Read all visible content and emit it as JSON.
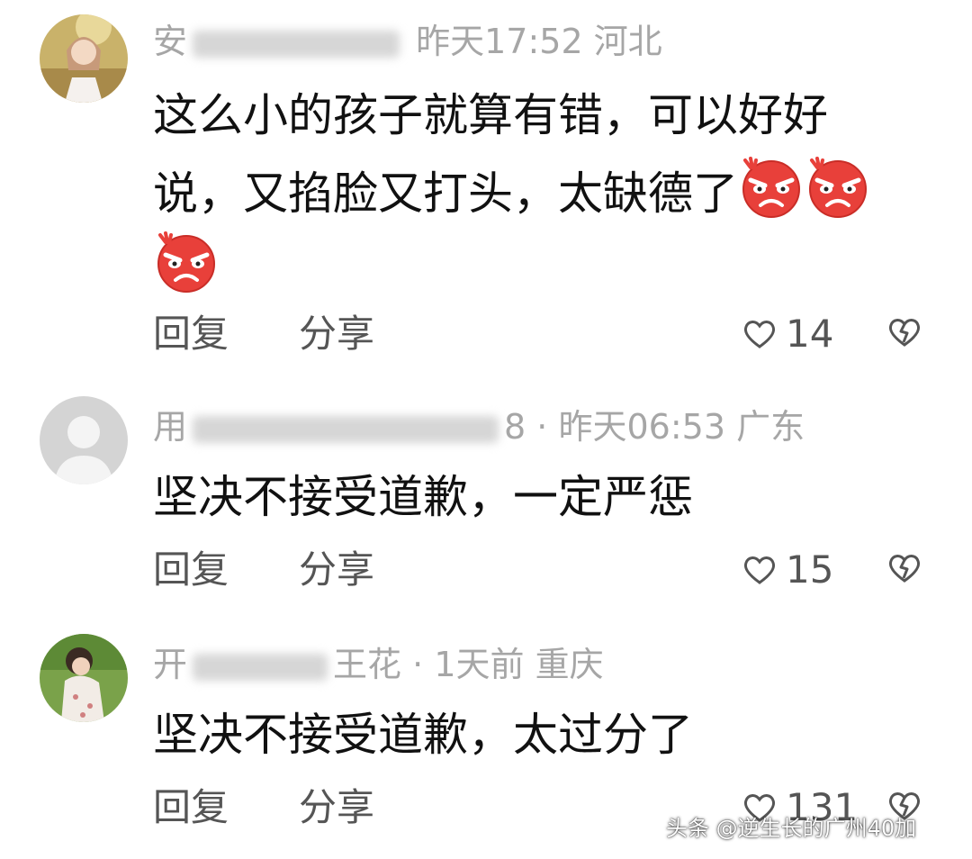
{
  "comments": [
    {
      "username_visible": "安",
      "time": "昨天17:52",
      "location": "河北",
      "text_line1": "这么小的孩子就算有错，可以好好",
      "text_line2": "说，又掐脸又打头，太缺德了",
      "emojis": [
        "angry-face",
        "angry-face",
        "angry-face"
      ],
      "reply_label": "回复",
      "share_label": "分享",
      "likes": "14"
    },
    {
      "username_visible": "用",
      "username_tail": "8",
      "separator": "·",
      "time": "昨天06:53",
      "location": "广东",
      "text": "坚决不接受道歉，一定严惩",
      "reply_label": "回复",
      "share_label": "分享",
      "likes": "15"
    },
    {
      "username_visible": "开",
      "username_tail": "王花",
      "separator": "·",
      "time": "1天前",
      "location": "重庆",
      "text": "坚决不接受道歉，太过分了",
      "reply_label": "回复",
      "share_label": "分享",
      "likes": "131"
    }
  ],
  "watermark": "头条 @逆生长的广州40加",
  "colors": {
    "text": "#111111",
    "meta": "#a6a6a6",
    "action": "#555555",
    "emoji": "#e8403a"
  }
}
